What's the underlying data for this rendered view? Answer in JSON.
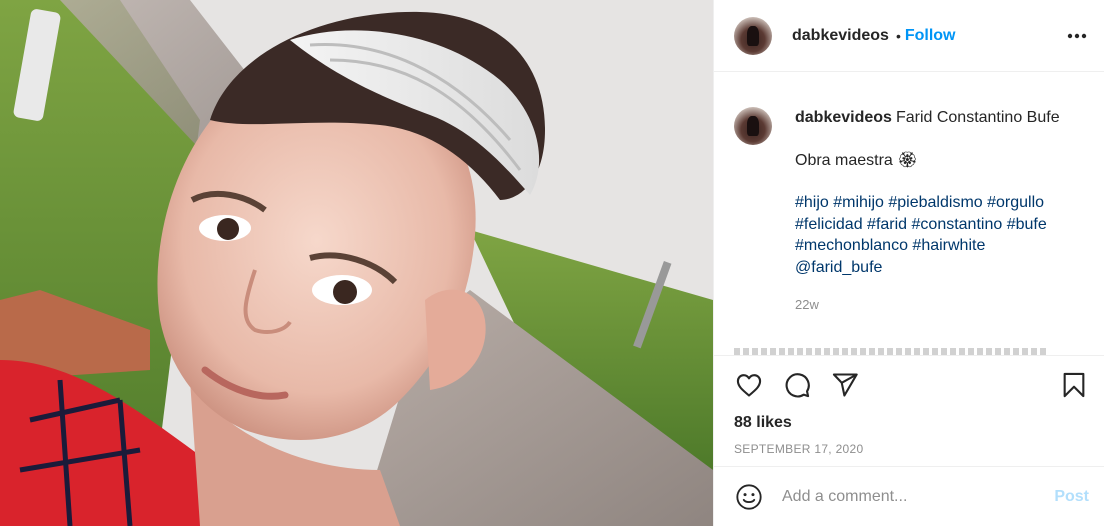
{
  "post": {
    "image_alt": "selfie of boy with white streak hair",
    "header": {
      "username": "dabkevideos",
      "separator": "•",
      "follow_label": "Follow",
      "more_icon": "more-horizontal-icon"
    },
    "caption": {
      "username": "dabkevideos",
      "first_line": "Farid Constantino Bufe",
      "second_line": "Obra maestra",
      "emoji": "🏵",
      "tag_lines": [
        "#hijo #mihijo #piebaldismo #orgullo",
        "#felicidad #farid #constantino #bufe",
        "#mechonblanco #hairwhite",
        "@farid_bufe"
      ],
      "time": "22w"
    },
    "actions": {
      "like_icon": "heart-icon",
      "comment_icon": "comment-icon",
      "share_icon": "paper-plane-icon",
      "save_icon": "bookmark-icon"
    },
    "likes": "88 likes",
    "date": "SEPTEMBER 17, 2020",
    "comment_box": {
      "emoji_icon": "smiley-icon",
      "placeholder": "Add a comment...",
      "post_label": "Post"
    }
  },
  "colors": {
    "accent": "#0095f6",
    "link": "#00376b",
    "muted": "#8e8e8e",
    "post_disabled": "#b2dffc"
  }
}
